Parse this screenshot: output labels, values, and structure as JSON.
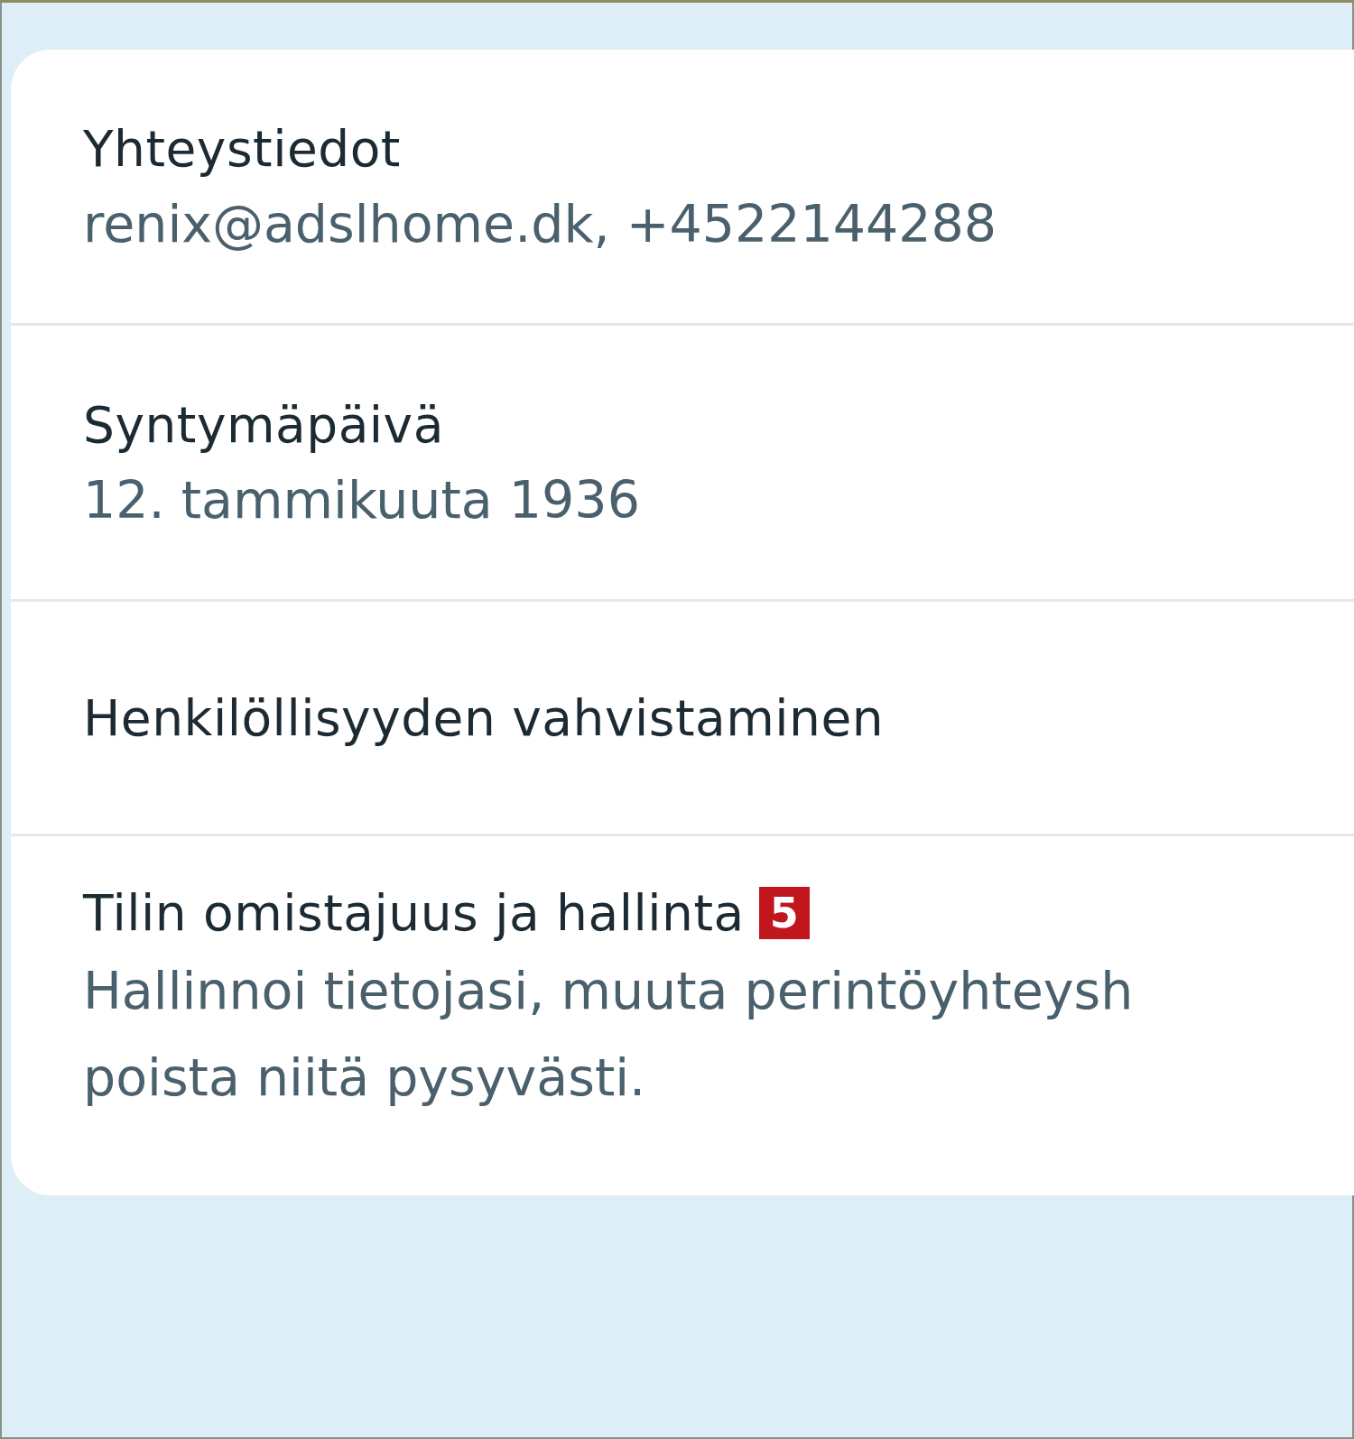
{
  "sections": [
    {
      "title": "Yhteystiedot",
      "value": "renix@adslhome.dk, +4522144288"
    },
    {
      "title": "Syntymäpäivä",
      "value": "12. tammikuuta 1936"
    },
    {
      "title": "Henkilöllisyyden vahvistaminen"
    },
    {
      "title": "Tilin omistajuus ja hallinta",
      "badge": "5",
      "description_lines": [
        "Hallinnoi tietojasi, muuta perintöyhteysh",
        "poista niitä pysyvästi."
      ]
    }
  ]
}
